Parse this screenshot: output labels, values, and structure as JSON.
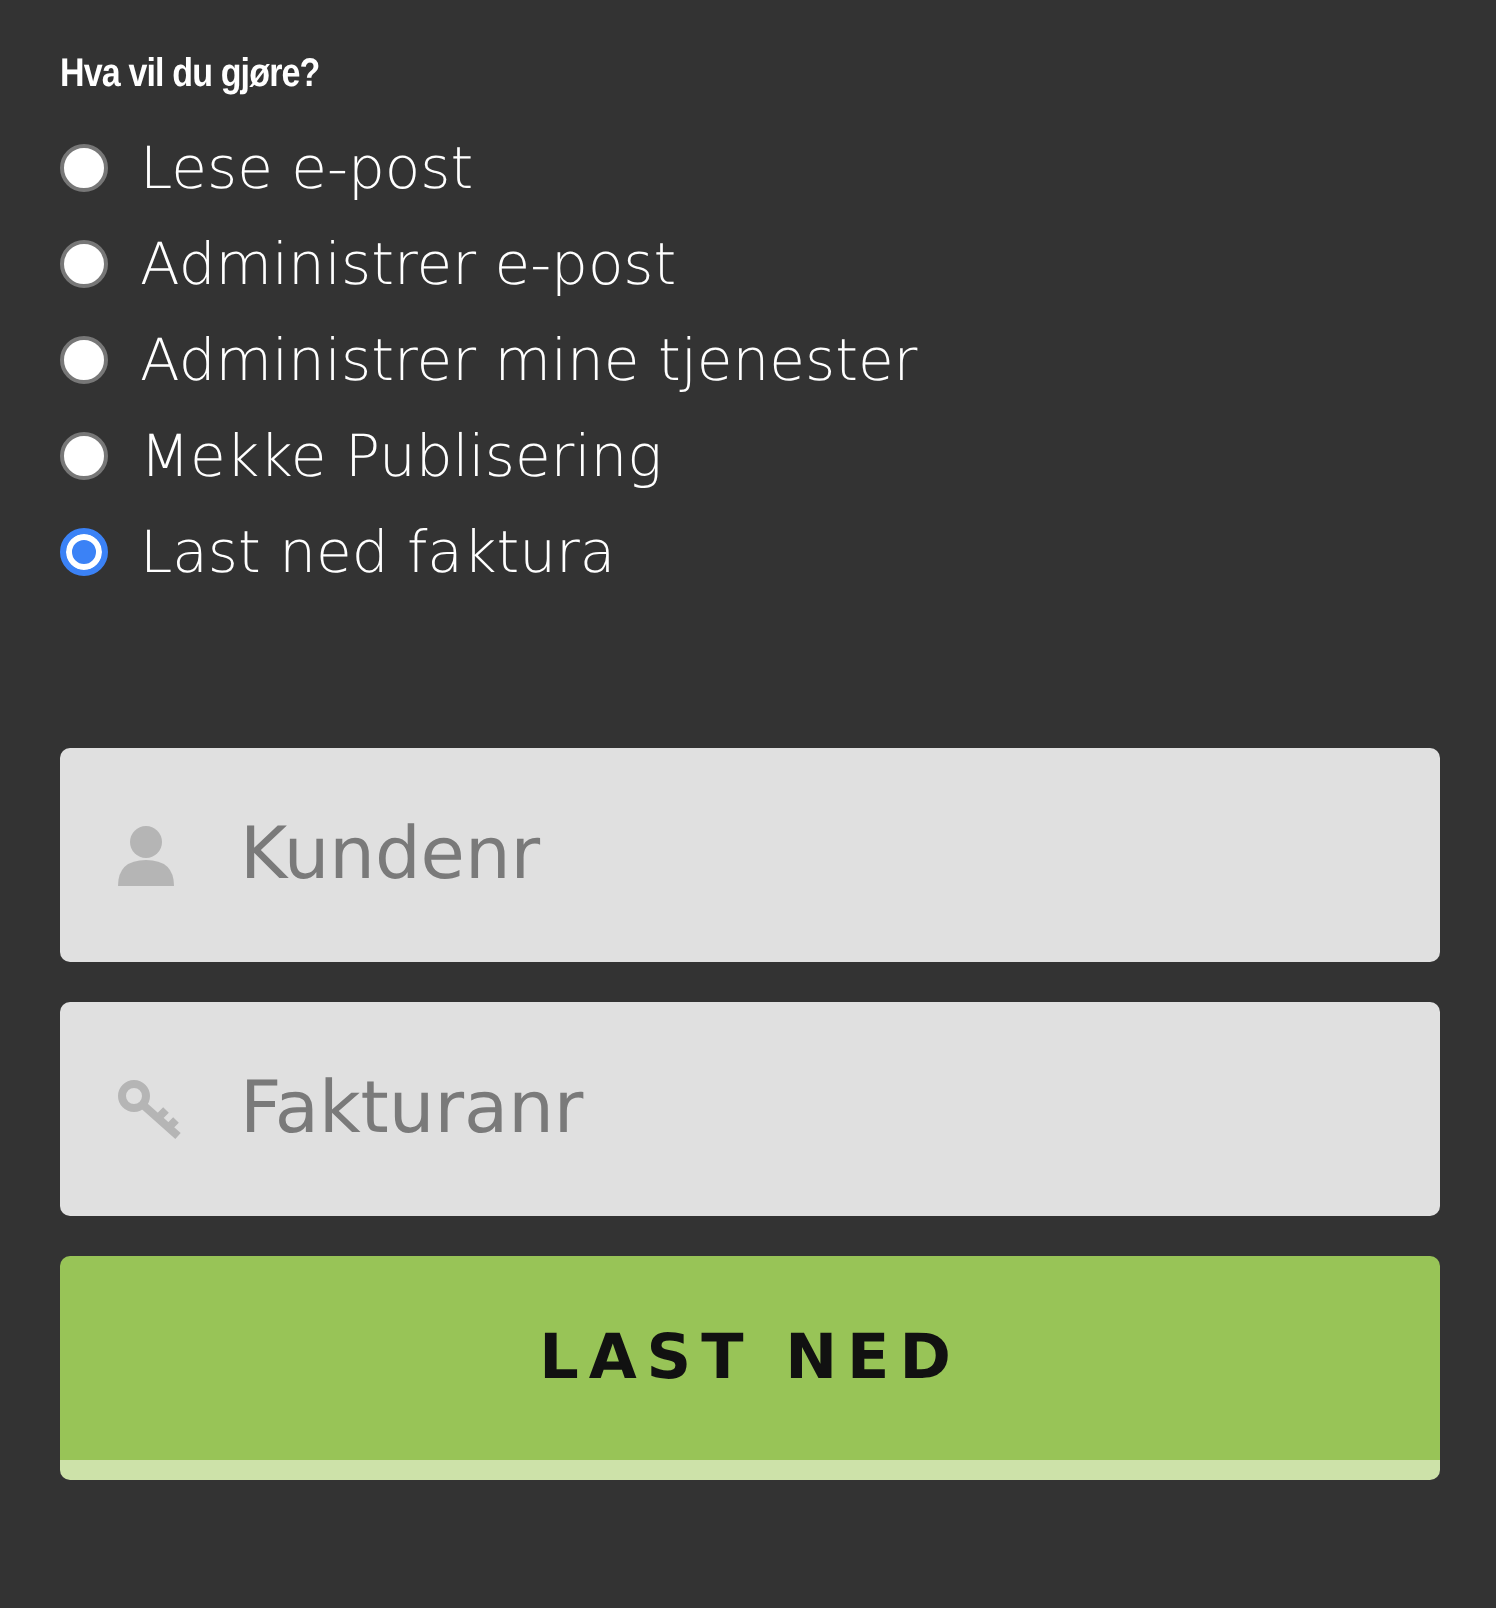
{
  "heading": "Hva vil du gjøre?",
  "options": [
    {
      "label": "Lese e-post",
      "selected": false
    },
    {
      "label": "Administrer e-post",
      "selected": false
    },
    {
      "label": "Administrer mine tjenester",
      "selected": false
    },
    {
      "label": "Mekke Publisering",
      "selected": false
    },
    {
      "label": "Last ned faktura",
      "selected": true
    }
  ],
  "fields": [
    {
      "kind": "user",
      "placeholder": "Kundenr"
    },
    {
      "kind": "key",
      "placeholder": "Fakturanr"
    }
  ],
  "button": "LAST NED"
}
